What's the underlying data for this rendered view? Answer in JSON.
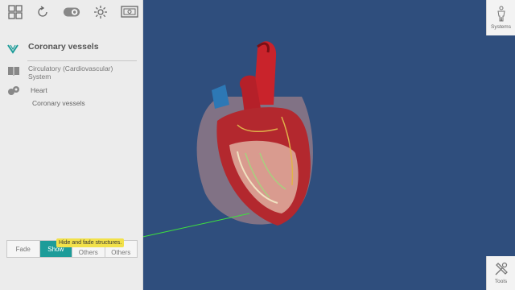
{
  "sidebar": {
    "breadcrumb_title": "Coronary vessels",
    "system_label": "Circulatory (Cardiovascular) System",
    "organ_label": "Heart",
    "structure_label": "Coronary vessels"
  },
  "bottom_buttons": [
    {
      "label": "Fade",
      "active": false
    },
    {
      "label": "Show",
      "active": true
    },
    {
      "label": "Others",
      "active": false
    },
    {
      "label": "Others",
      "active": false
    }
  ],
  "tooltip": "Hide and fade structures.",
  "right_panel": {
    "systems_label": "Systems",
    "tools_label": "Tools"
  },
  "colors": {
    "viewport_bg": "#2f4e7d",
    "accent": "#1d9c99",
    "tooltip_bg": "#f2e14a",
    "logo": "#1d9c99"
  }
}
